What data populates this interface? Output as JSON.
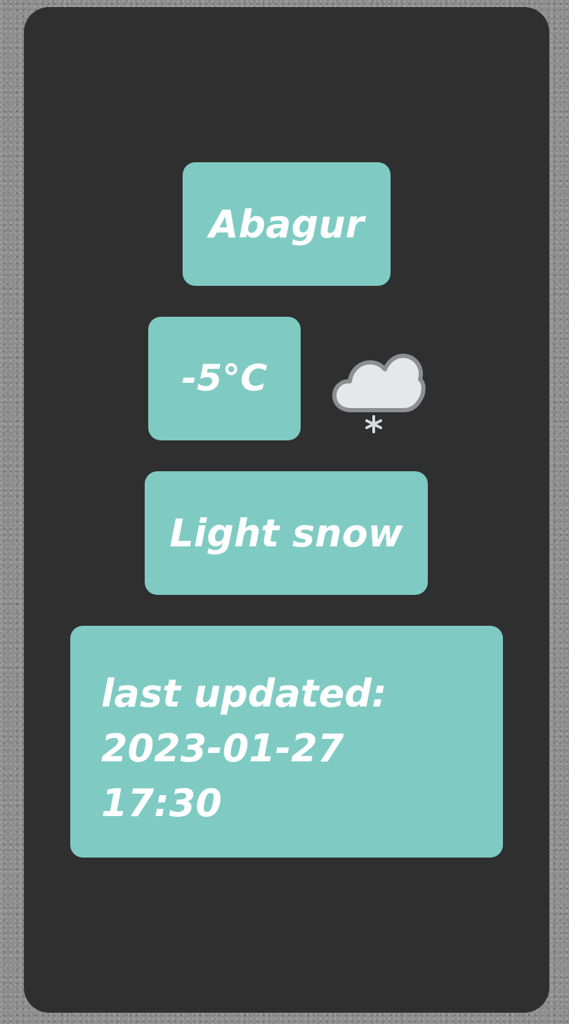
{
  "weather": {
    "city": "Abagur",
    "temperature": "-5°C",
    "condition": "Light snow",
    "condition_icon": "cloud-snow-icon",
    "last_updated_label": "last updated:",
    "last_updated_date": "2023-01-27",
    "last_updated_time": "17:30"
  },
  "colors": {
    "card_background": "#2f2f2f",
    "tile_background": "#7fcbc3",
    "text": "#ffffff",
    "page_background": "#8e8e8e"
  }
}
